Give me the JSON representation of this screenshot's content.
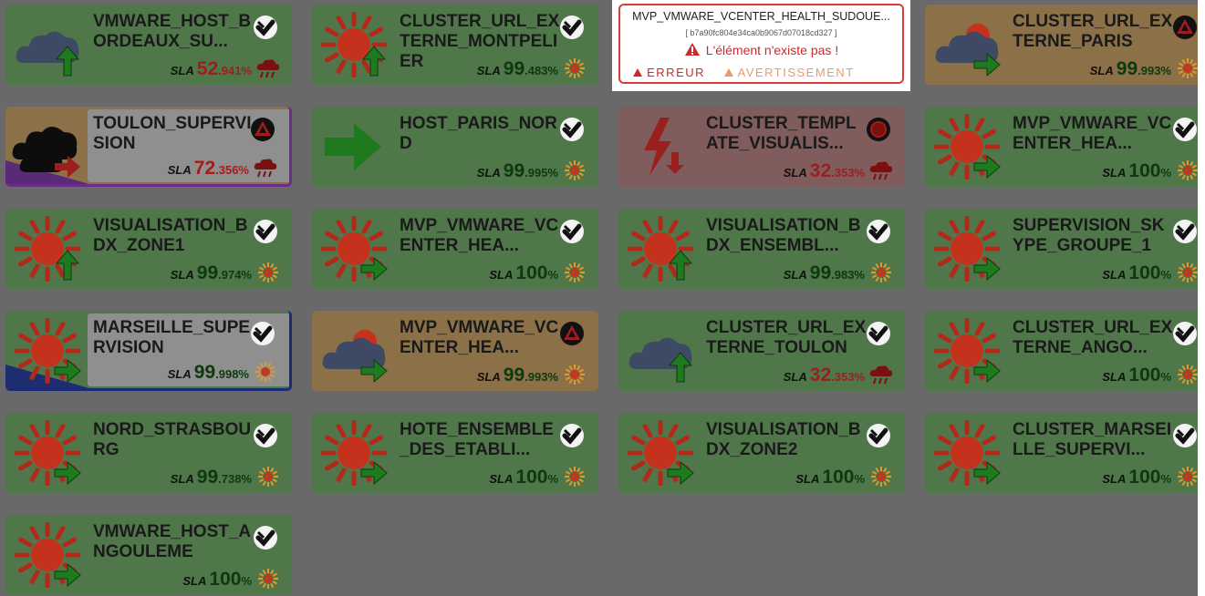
{
  "tooltip": {
    "title": "MVP_VMWARE_VCENTER_HEALTH_SUDOUE...",
    "id": "[ b7a90fc804e34ca0b9067d07018cd327 ]",
    "message": "L'élément n'existe pas !",
    "error_label": "ERREUR",
    "warning_label": "AVERTISSEMENT"
  },
  "sla_label": "SLA",
  "percent_sign": "%",
  "colors": {
    "ok": "#4f774a",
    "warn": "#8b7048",
    "crit": "#805c5c",
    "bad_text": "#a11d1d"
  },
  "tiles": [
    {
      "name": "VMWARE_HOST_BORDEAUX_SU...",
      "sla_int": "52",
      "sla_dec": ".941",
      "tone": "green",
      "weather": "cloud-rain-icon",
      "arrow": "up",
      "status": "check-icon",
      "small": "rain-cloud-icon",
      "bad": true
    },
    {
      "name": "CLUSTER_URL_EXTERNE_MONTPELIER",
      "sla_int": "99",
      "sla_dec": ".483",
      "tone": "green",
      "weather": "sun-icon",
      "arrow": "up",
      "status": "check-icon",
      "small": "sun-icon",
      "bad": false
    },
    {
      "name": "",
      "sla_int": "",
      "sla_dec": "",
      "tone": "hidden",
      "weather": "",
      "arrow": "",
      "status": "",
      "small": "",
      "bad": false
    },
    {
      "name": "CLUSTER_URL_EXTERNE_PARIS",
      "sla_int": "99",
      "sla_dec": ".993",
      "tone": "orange",
      "weather": "cloud-sun-icon",
      "arrow": "right",
      "status": "alert-triangle-icon",
      "small": "sun-icon",
      "bad": false
    },
    {
      "name": "TOULON_SUPERVISION",
      "sla_int": "72",
      "sla_dec": ".356",
      "tone": "mixed-orange",
      "weather": "storm-cloud-icon",
      "arrow": "right",
      "status": "alert-triangle-icon",
      "small": "rain-cloud-icon",
      "bad": true
    },
    {
      "name": "HOST_PARIS_NORD",
      "sla_int": "99",
      "sla_dec": ".995",
      "tone": "green",
      "weather": "arrow-right-icon",
      "arrow": "",
      "status": "check-icon",
      "small": "sun-icon",
      "bad": false
    },
    {
      "name": "CLUSTER_TEMPLATE_VISUALIS...",
      "sla_int": "32",
      "sla_dec": ".353",
      "tone": "red",
      "weather": "lightning-icon",
      "arrow": "",
      "status": "critical-icon",
      "small": "rain-cloud-icon",
      "bad": true
    },
    {
      "name": "MVP_VMWARE_VCENTER_HEA...",
      "sla_int": "100",
      "sla_dec": "",
      "tone": "green",
      "weather": "sun-icon",
      "arrow": "right",
      "status": "check-icon",
      "small": "sun-icon",
      "bad": false
    },
    {
      "name": "VISUALISATION_BDX_ZONE1",
      "sla_int": "99",
      "sla_dec": ".974",
      "tone": "green",
      "weather": "sun-icon",
      "arrow": "up",
      "status": "check-icon",
      "small": "sun-icon",
      "bad": false
    },
    {
      "name": "MVP_VMWARE_VCENTER_HEA...",
      "sla_int": "100",
      "sla_dec": "",
      "tone": "green",
      "weather": "sun-icon",
      "arrow": "right",
      "status": "check-icon",
      "small": "sun-icon",
      "bad": false
    },
    {
      "name": "VISUALISATION_BDX_ENSEMBL...",
      "sla_int": "99",
      "sla_dec": ".983",
      "tone": "green",
      "weather": "sun-icon",
      "arrow": "up",
      "status": "check-icon",
      "small": "sun-icon",
      "bad": false
    },
    {
      "name": "SUPERVISION_SKYPE_GROUPE_1",
      "sla_int": "100",
      "sla_dec": "",
      "tone": "green",
      "weather": "sun-icon",
      "arrow": "right",
      "status": "check-icon",
      "small": "sun-icon",
      "bad": false
    },
    {
      "name": "MARSEILLE_SUPERVISION",
      "sla_int": "99",
      "sla_dec": ".998",
      "tone": "mixed-blue",
      "weather": "sun-icon",
      "arrow": "right",
      "status": "check-icon",
      "small": "sun-icon",
      "bad": false
    },
    {
      "name": "MVP_VMWARE_VCENTER_HEA...",
      "sla_int": "99",
      "sla_dec": ".993",
      "tone": "orange",
      "weather": "cloud-sun-icon",
      "arrow": "right",
      "status": "alert-triangle-icon",
      "small": "sun-icon",
      "bad": false
    },
    {
      "name": "CLUSTER_URL_EXTERNE_TOULON",
      "sla_int": "32",
      "sla_dec": ".353",
      "tone": "green",
      "weather": "cloud-icon",
      "arrow": "up",
      "status": "check-icon",
      "small": "rain-cloud-icon",
      "bad": true
    },
    {
      "name": "CLUSTER_URL_EXTERNE_ANGO...",
      "sla_int": "100",
      "sla_dec": "",
      "tone": "green",
      "weather": "sun-icon",
      "arrow": "right",
      "status": "check-icon",
      "small": "sun-icon",
      "bad": false
    },
    {
      "name": "NORD_STRASBOURG",
      "sla_int": "99",
      "sla_dec": ".738",
      "tone": "green",
      "weather": "sun-icon",
      "arrow": "right",
      "status": "check-icon",
      "small": "sun-icon",
      "bad": false
    },
    {
      "name": "HOTE_ENSEMBLE_DES_ETABLI...",
      "sla_int": "100",
      "sla_dec": "",
      "tone": "green",
      "weather": "sun-icon",
      "arrow": "right",
      "status": "check-icon",
      "small": "sun-icon",
      "bad": false
    },
    {
      "name": "VISUALISATION_BDX_ZONE2",
      "sla_int": "100",
      "sla_dec": "",
      "tone": "green",
      "weather": "sun-icon",
      "arrow": "right",
      "status": "check-icon",
      "small": "sun-icon",
      "bad": false
    },
    {
      "name": "CLUSTER_MARSEILLE_SUPERVI...",
      "sla_int": "100",
      "sla_dec": "",
      "tone": "green",
      "weather": "sun-icon",
      "arrow": "right",
      "status": "check-icon",
      "small": "sun-icon",
      "bad": false
    },
    {
      "name": "VMWARE_HOST_ANGOULEME",
      "sla_int": "100",
      "sla_dec": "",
      "tone": "green",
      "weather": "sun-icon",
      "arrow": "right",
      "status": "check-icon",
      "small": "sun-icon",
      "bad": false
    }
  ]
}
